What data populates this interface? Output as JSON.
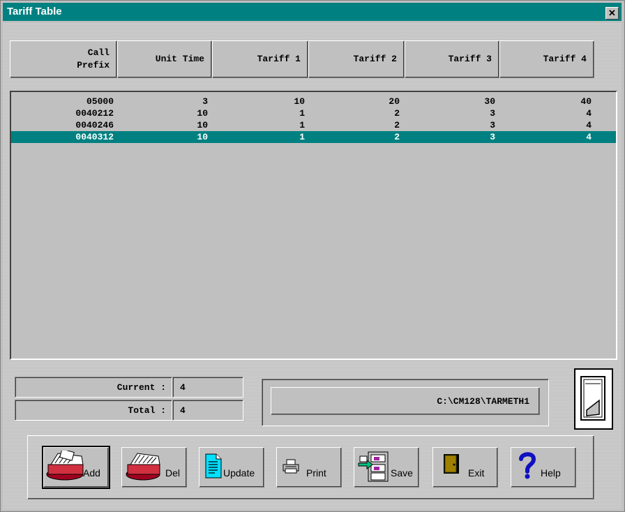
{
  "window": {
    "title": "Tariff Table",
    "close_glyph": "✕"
  },
  "table": {
    "columns": [
      "Call\nPrefix",
      "Unit Time",
      "Tariff 1",
      "Tariff 2",
      "Tariff 3",
      "Tariff 4"
    ],
    "rows": [
      [
        "05000",
        "3",
        "10",
        "20",
        "30",
        "40"
      ],
      [
        "0040212",
        "10",
        "1",
        "2",
        "3",
        "4"
      ],
      [
        "0040246",
        "10",
        "1",
        "2",
        "3",
        "4"
      ],
      [
        "0040312",
        "10",
        "1",
        "2",
        "3",
        "4"
      ]
    ],
    "selected_row": 3
  },
  "status": {
    "current_label": "Current :",
    "current_value": "4",
    "total_label": "Total :",
    "total_value": "4",
    "file_path": "C:\\CM128\\TARMETH1"
  },
  "buttons": {
    "add": "Add",
    "del": "Del",
    "update": "Update",
    "print": "Print",
    "save": "Save",
    "exit": "Exit",
    "help": "Help"
  },
  "icons": {
    "add": "card-file-add-icon",
    "del": "card-file-delete-icon",
    "update": "document-icon",
    "print": "printer-icon",
    "save": "file-cabinet-save-icon",
    "exit": "door-exit-icon",
    "help": "question-mark-icon",
    "switch": "power-switch-icon"
  },
  "colors": {
    "titlebar": "#008080",
    "selection": "#008080",
    "face": "#c0c0c0"
  }
}
